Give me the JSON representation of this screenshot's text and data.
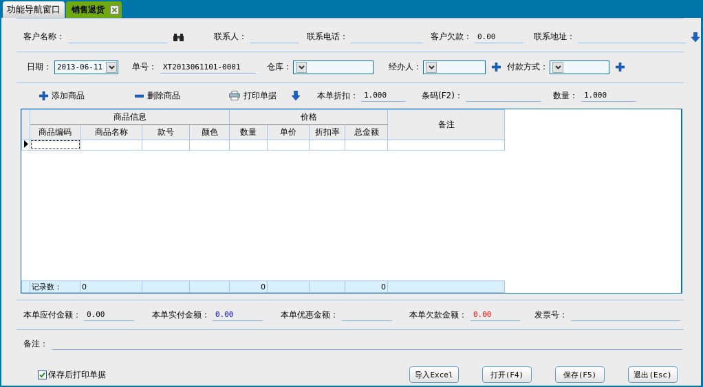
{
  "tabs": [
    {
      "label": "功能导航窗口",
      "selected": false,
      "closable": false
    },
    {
      "label": "销售退货",
      "selected": true,
      "closable": true
    }
  ],
  "customer_row": [
    {
      "label": "客户名称：",
      "kind": "text",
      "lookup": true
    },
    {
      "label": "联系人：",
      "kind": "text"
    },
    {
      "label": "联系电话：",
      "kind": "text"
    },
    {
      "label": "客户欠款：",
      "kind": "text",
      "value": "0.00"
    },
    {
      "label": "联系地址：",
      "kind": "text"
    }
  ],
  "order_row": [
    {
      "label": "日期：",
      "kind": "combo",
      "value": "2013-06-11"
    },
    {
      "label": "单号：",
      "kind": "text",
      "value": "XT2013061101-0001"
    },
    {
      "label": "仓库：",
      "kind": "combo"
    },
    {
      "label": "经办人：",
      "kind": "combo",
      "addable": true
    },
    {
      "label": "付款方式：",
      "kind": "combo",
      "addable": true
    }
  ],
  "toolbar": [
    {
      "label": "添加商品",
      "kind": "add"
    },
    {
      "label": "删除商品",
      "kind": "remove"
    },
    {
      "label": "打印单据",
      "kind": "print"
    }
  ],
  "entry_row": [
    {
      "label": "本单折扣：",
      "kind": "text",
      "value": "1.000"
    },
    {
      "label": "条码(F2)：",
      "kind": "text"
    },
    {
      "label": "数量：",
      "kind": "text",
      "value": "1.000"
    }
  ],
  "grid": {
    "column_groups": [
      {
        "label": "商品信息",
        "columns": [
          "商品编码",
          "商品名称",
          "款号",
          "颜色"
        ]
      },
      {
        "label": "价格",
        "columns": [
          "数量",
          "单价",
          "折扣率",
          "总金额"
        ]
      },
      {
        "label": "备注"
      }
    ],
    "rows": [
      {
        "current": true
      }
    ],
    "footer": {
      "label": "记录数：",
      "count": "0",
      "quantity_total": "0",
      "amount_total": "0"
    }
  },
  "totals_row": [
    {
      "label": "本单应付金额：",
      "kind": "text",
      "value": "0.00",
      "color": "#000000"
    },
    {
      "label": "本单实付金额：",
      "kind": "text",
      "value": "0.00",
      "color": "#0000ff"
    },
    {
      "label": "本单优惠金额：",
      "kind": "text"
    },
    {
      "label": "本单欠款金额：",
      "kind": "text",
      "value": "0.00",
      "color": "#ff0000"
    },
    {
      "label": "发票号：",
      "kind": "text"
    }
  ],
  "remarks": {
    "label": "备注："
  },
  "print_after_save": {
    "label": "保存后打印单据",
    "checked": true
  },
  "buttons": [
    "导入Excel",
    "打开(F4)",
    "保存(F5)",
    "退出(Esc)"
  ]
}
